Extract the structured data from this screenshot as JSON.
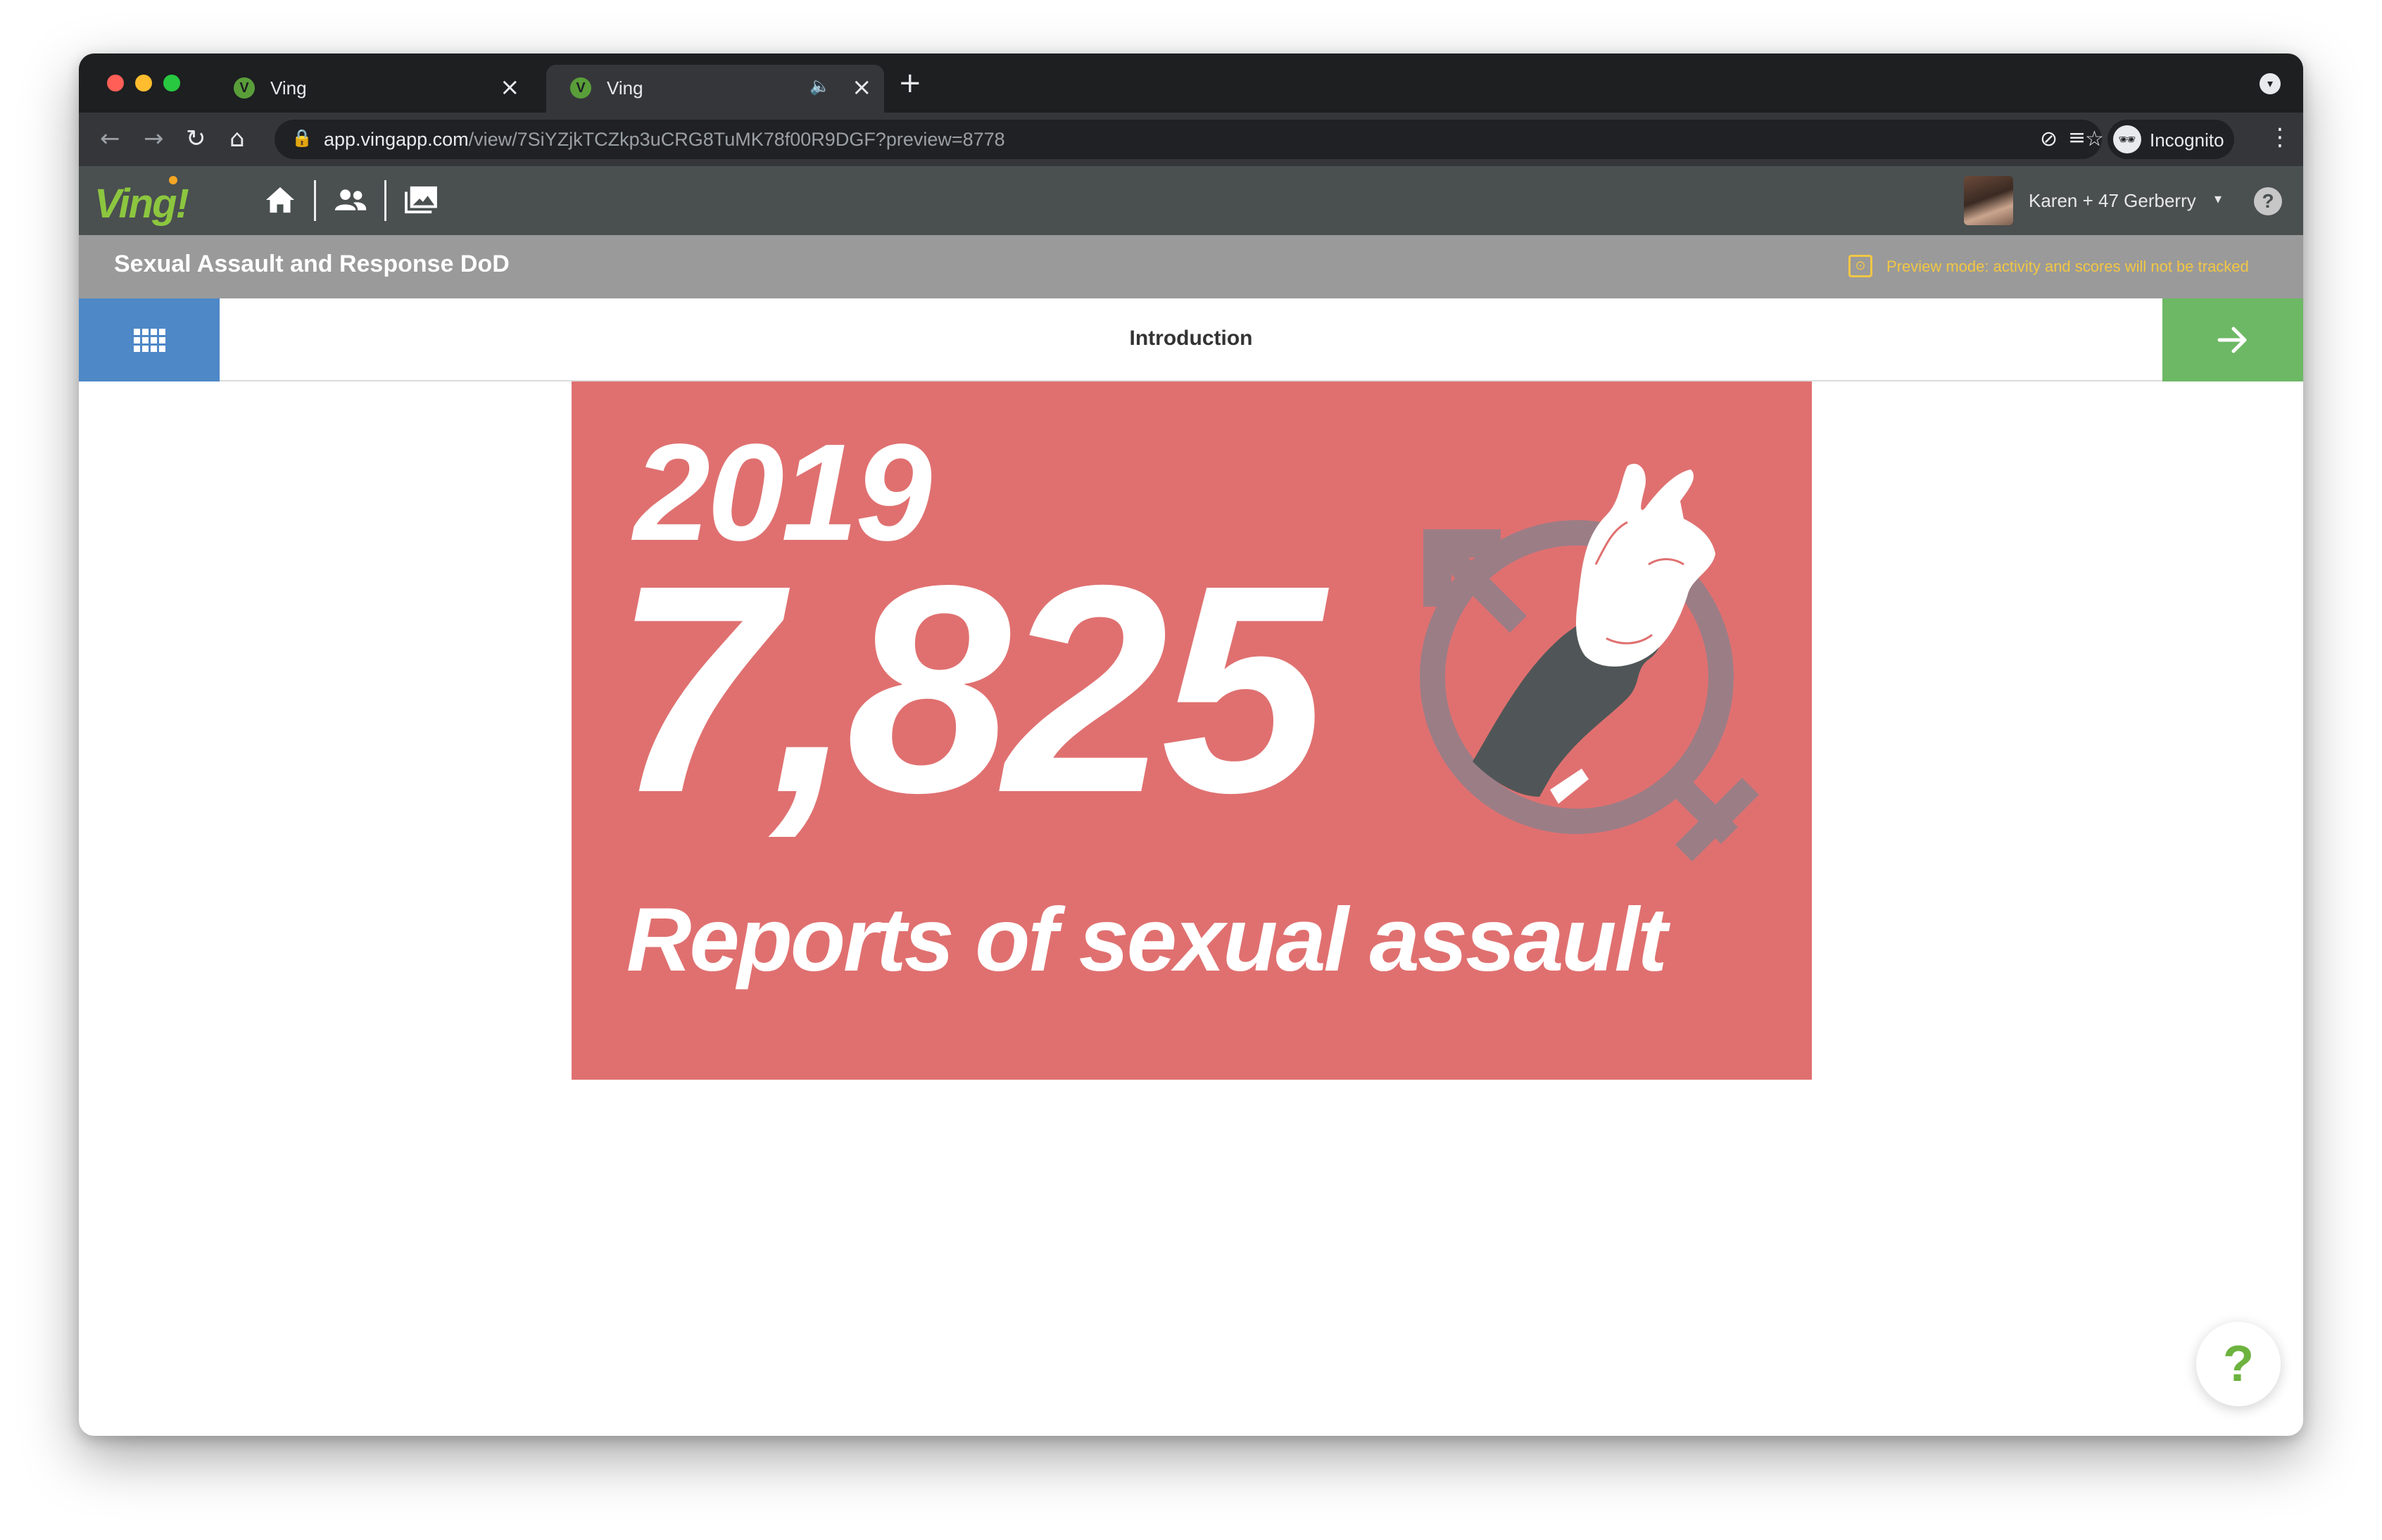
{
  "browser": {
    "tabs": [
      {
        "title": "Ving",
        "favicon": "V",
        "close": "×"
      },
      {
        "title": "Ving",
        "favicon": "V",
        "close": "×",
        "audio": "🔈"
      }
    ],
    "new_tab": "+",
    "url_host": "app.vingapp.com",
    "url_path": "/view/7SiYZjkTCZkp3uCRG8TuMK78f00R9DGF?preview=8778",
    "profile": "Incognito",
    "icons": {
      "back": "←",
      "forward": "→",
      "reload": "↻",
      "home": "⌂",
      "lock": "🔒",
      "eye_off": "⊘",
      "star": "☆",
      "reading_list": "≡",
      "menu": "⋮",
      "tab_search": "▾",
      "incognito": "🕶"
    }
  },
  "app": {
    "logo": "Ving!",
    "user_name": "Karen + 47 Gerberry",
    "user_caret": "▾",
    "help": "?"
  },
  "course": {
    "title": "Sexual Assault and Response DoD",
    "preview_notice": "Preview mode: activity and scores will not be tracked",
    "preview_icon": "⊙"
  },
  "step": {
    "title": "Introduction"
  },
  "slide": {
    "year": "2019",
    "number": "7,825",
    "caption": "Reports of sexual assault",
    "colors": {
      "background": "#e07070",
      "symbol": "#9b7d86",
      "dark_hand": "#505657",
      "light_hand": "#ffffff"
    }
  },
  "floating_help": "?",
  "colors": {
    "app_header": "#4a4f50",
    "title_bar": "#9a9a9a",
    "menu_button": "#4e88c7",
    "next_button": "#6db865",
    "preview_text": "#f2c744"
  }
}
